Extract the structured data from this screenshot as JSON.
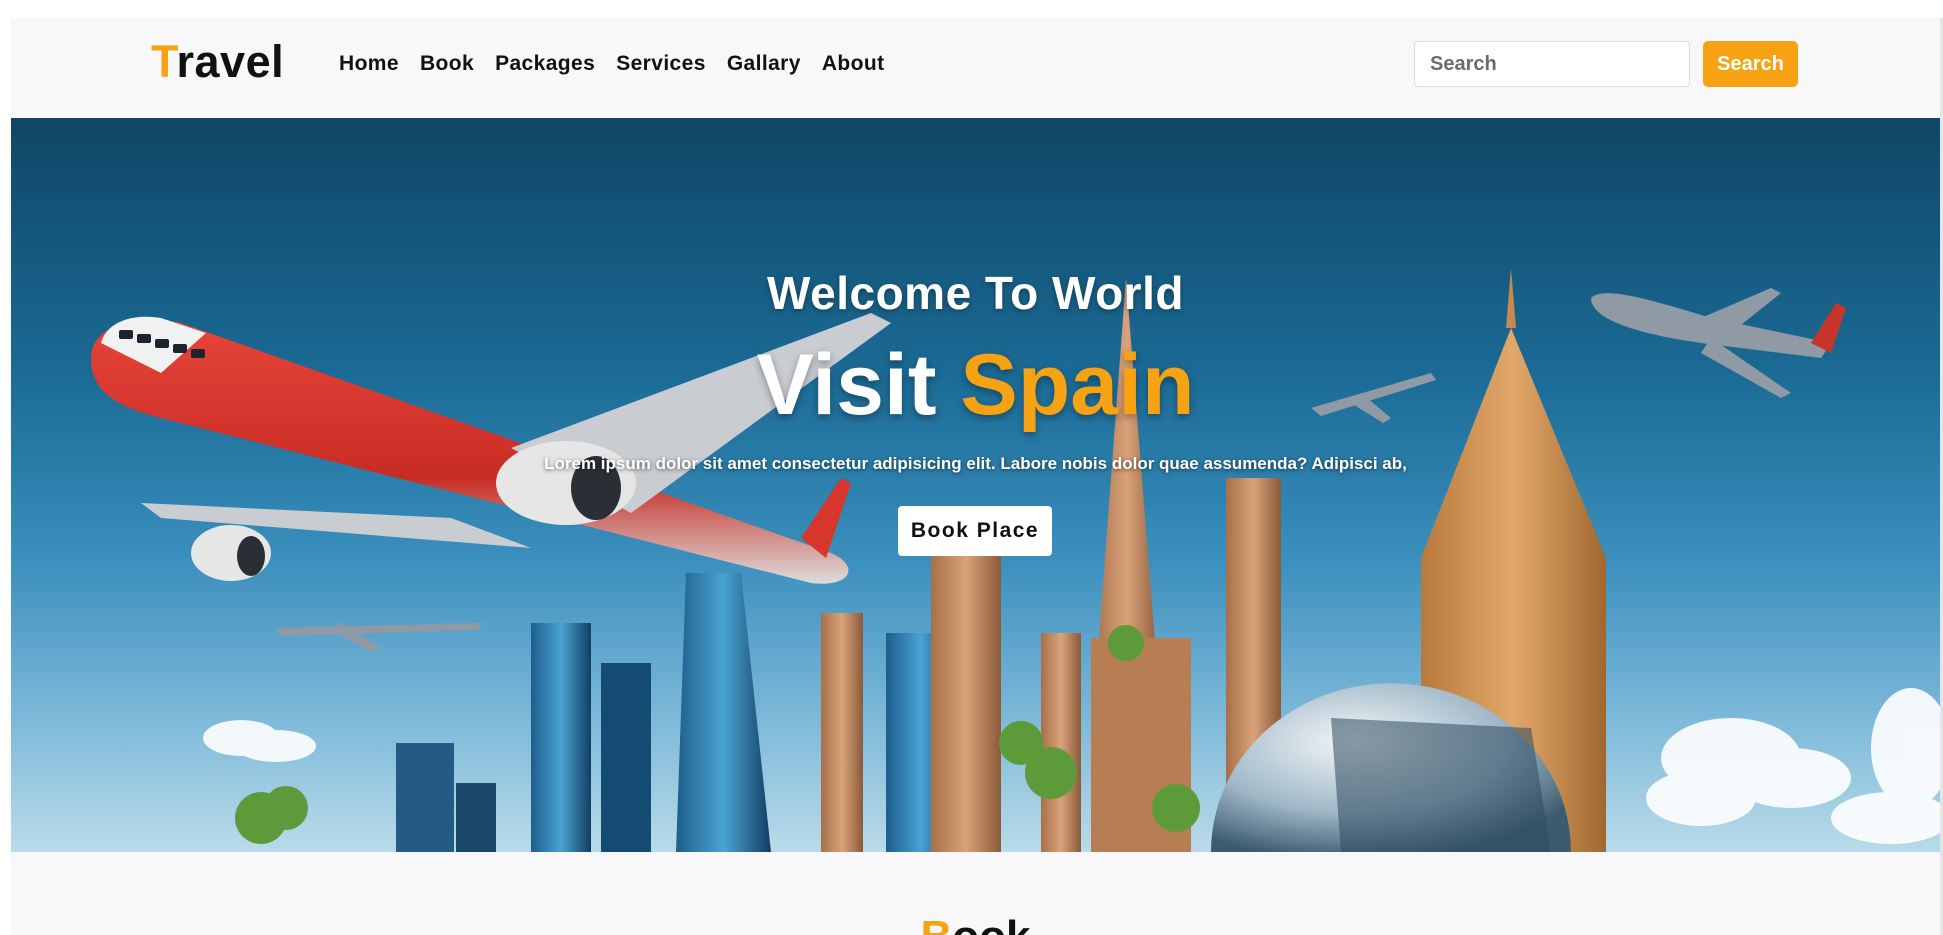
{
  "brand": {
    "first_letter": "T",
    "rest": "ravel"
  },
  "nav": {
    "links": [
      "Home",
      "Book",
      "Packages",
      "Services",
      "Gallary",
      "About"
    ]
  },
  "search": {
    "placeholder": "Search",
    "button_label": "Search"
  },
  "hero": {
    "welcome": "Welcome To World",
    "title_plain": "Visit ",
    "title_highlight": "Spain",
    "description": "Lorem ipsum dolor sit amet consectetur adipisicing elit. Labore nobis dolor quae assumenda? Adipisci ab,",
    "button_label": "Book Place"
  },
  "next_section": {
    "heading_first": "B",
    "heading_rest": "ook"
  },
  "colors": {
    "accent": "#f7a213",
    "nav_bg": "#f8f8fa",
    "text_dark": "#111111",
    "hero_sky_top": "#0f4666",
    "hero_sky_bottom": "#b9dbe9"
  }
}
